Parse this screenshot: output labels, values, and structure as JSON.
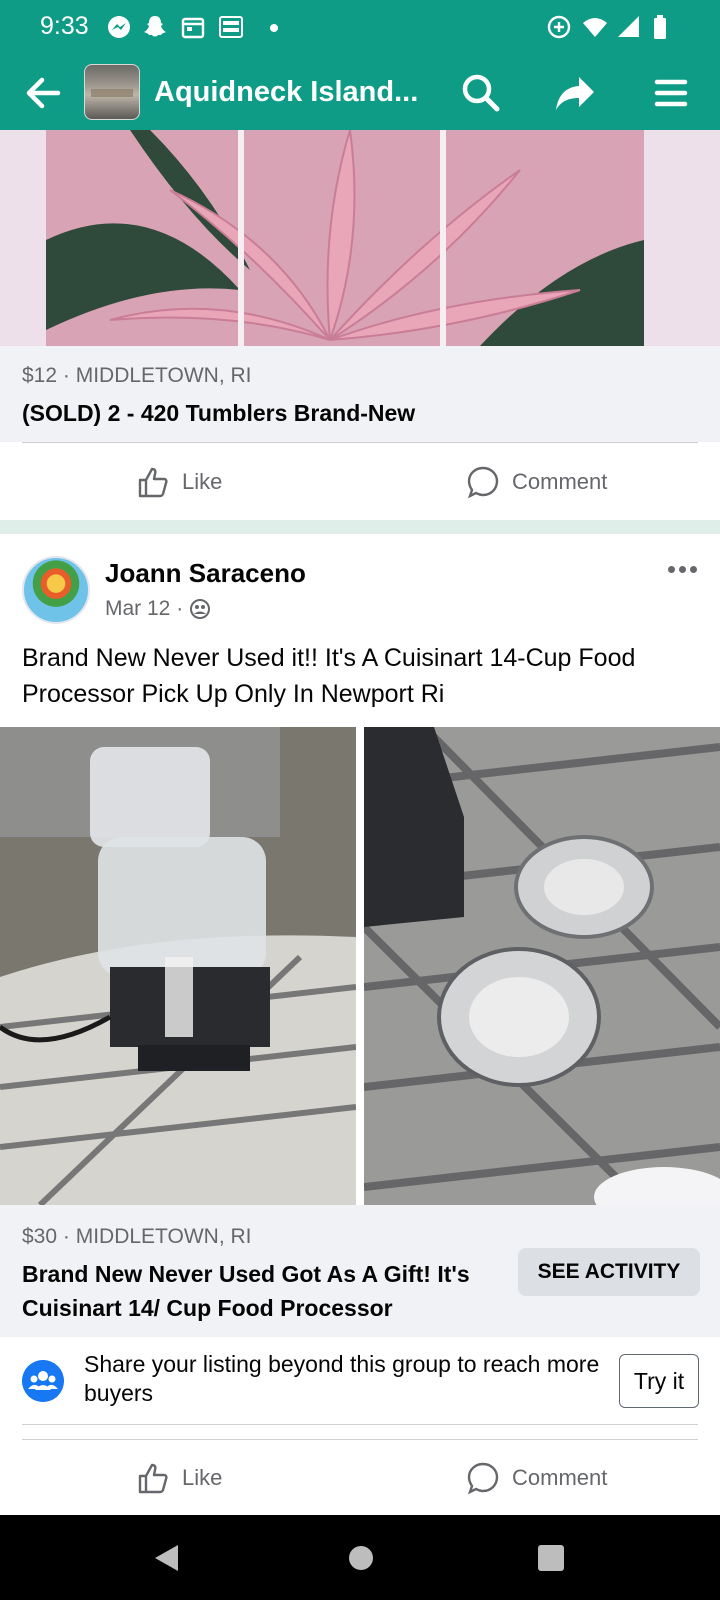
{
  "status_bar": {
    "time": "9:33"
  },
  "app_bar": {
    "title": "Aquidneck Island..."
  },
  "sold_post": {
    "price_location": "$12 · MIDDLETOWN, RI",
    "title": "(SOLD) 2 - 420 Tumblers Brand-New",
    "like_label": "Like",
    "comment_label": "Comment"
  },
  "post": {
    "author": "Joann Saraceno",
    "date": "Mar 12 ·",
    "body": "Brand New Never Used it!! It's A Cuisinart 14-Cup Food Processor Pick Up Only In Newport Ri",
    "price_location": "$30 · MIDDLETOWN, RI",
    "listing_title": "Brand New Never Used Got As A Gift! It's Cuisinart 14/ Cup Food Processor",
    "see_activity_label": "SEE ACTIVITY",
    "share_prompt": "Share your listing beyond this group to reach more buyers",
    "try_label": "Try it",
    "like_label": "Like",
    "comment_label": "Comment"
  },
  "icons": {
    "status": [
      "messenger-icon",
      "snapchat-icon",
      "calendar-icon",
      "news-icon",
      "data-saver-icon",
      "wifi-icon",
      "signal-icon",
      "battery-icon"
    ],
    "app_bar": [
      "back-arrow-icon",
      "search-icon",
      "share-icon",
      "menu-icon"
    ],
    "nav": [
      "back-triangle-icon",
      "home-circle-icon",
      "recents-square-icon"
    ]
  },
  "colors": {
    "brand_teal": "#0f9c87",
    "fb_blue": "#1877f2",
    "secondary_text": "#65676b",
    "listing_bg": "#f0f2f5"
  }
}
